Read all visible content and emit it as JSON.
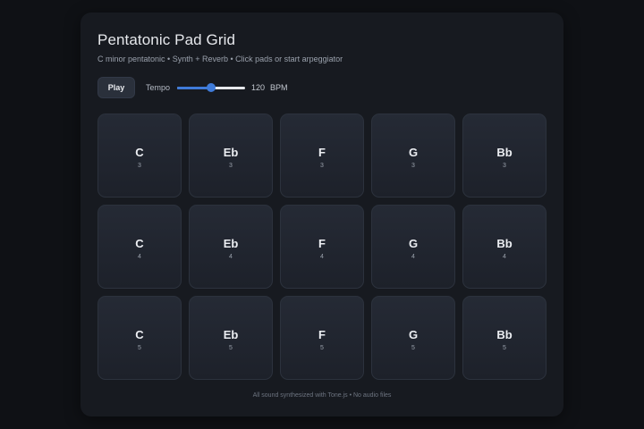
{
  "header": {
    "title": "Pentatonic Pad Grid",
    "subtitle": "C minor pentatonic • Synth + Reverb • Click pads or start arpeggiator"
  },
  "controls": {
    "play_label": "Play",
    "tempo_label": "Tempo",
    "tempo_value": "120",
    "tempo_unit": "BPM",
    "tempo_slider_fraction": 0.5
  },
  "pads": {
    "rows": [
      [
        {
          "note": "C",
          "octave": "3"
        },
        {
          "note": "Eb",
          "octave": "3"
        },
        {
          "note": "F",
          "octave": "3"
        },
        {
          "note": "G",
          "octave": "3"
        },
        {
          "note": "Bb",
          "octave": "3"
        }
      ],
      [
        {
          "note": "C",
          "octave": "4"
        },
        {
          "note": "Eb",
          "octave": "4"
        },
        {
          "note": "F",
          "octave": "4"
        },
        {
          "note": "G",
          "octave": "4"
        },
        {
          "note": "Bb",
          "octave": "4"
        }
      ],
      [
        {
          "note": "C",
          "octave": "5"
        },
        {
          "note": "Eb",
          "octave": "5"
        },
        {
          "note": "F",
          "octave": "5"
        },
        {
          "note": "G",
          "octave": "5"
        },
        {
          "note": "Bb",
          "octave": "5"
        }
      ]
    ]
  },
  "footer": {
    "text": "All sound synthesized with Tone.js • No audio files"
  },
  "colors": {
    "accent": "#3f7bd9",
    "background": "#0f1115",
    "panel": "#171a20"
  }
}
